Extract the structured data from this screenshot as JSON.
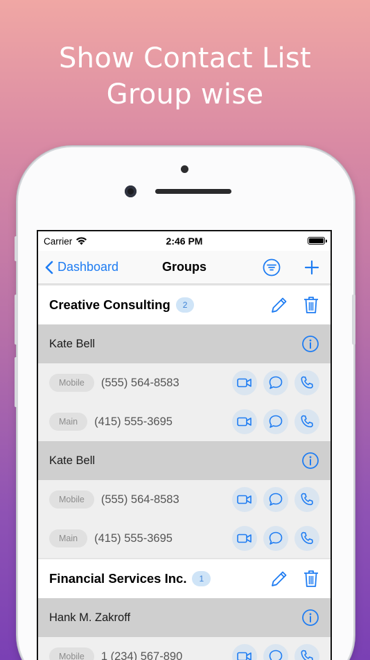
{
  "headline": {
    "line1": "Show Contact List",
    "line2": "Group wise"
  },
  "status_bar": {
    "carrier": "Carrier",
    "time": "2:46 PM"
  },
  "nav": {
    "back_label": "Dashboard",
    "title": "Groups"
  },
  "colors": {
    "accent": "#1e7cf2",
    "badge_bg": "#cfe4f7",
    "contact_header_bg": "#cfcfcf",
    "phone_row_bg": "#efefef"
  },
  "groups": [
    {
      "name": "Creative Consulting",
      "count": "2",
      "contacts": [
        {
          "name": "Kate Bell",
          "phones": [
            {
              "type": "Mobile",
              "number": "(555) 564-8583"
            },
            {
              "type": "Main",
              "number": "(415) 555-3695"
            }
          ]
        },
        {
          "name": "Kate Bell",
          "phones": [
            {
              "type": "Mobile",
              "number": "(555) 564-8583"
            },
            {
              "type": "Main",
              "number": "(415) 555-3695"
            }
          ]
        }
      ]
    },
    {
      "name": "Financial Services Inc.",
      "count": "1",
      "contacts": [
        {
          "name": "Hank M. Zakroff",
          "phones": [
            {
              "type": "Mobile",
              "number": "1 (234) 567-890"
            }
          ]
        }
      ]
    }
  ],
  "icons": {
    "back": "chevron-left-icon",
    "filter": "filter-icon",
    "add": "plus-icon",
    "edit": "pencil-icon",
    "delete": "trash-icon",
    "info": "info-icon",
    "video": "video-icon",
    "message": "message-icon",
    "call": "phone-icon"
  }
}
